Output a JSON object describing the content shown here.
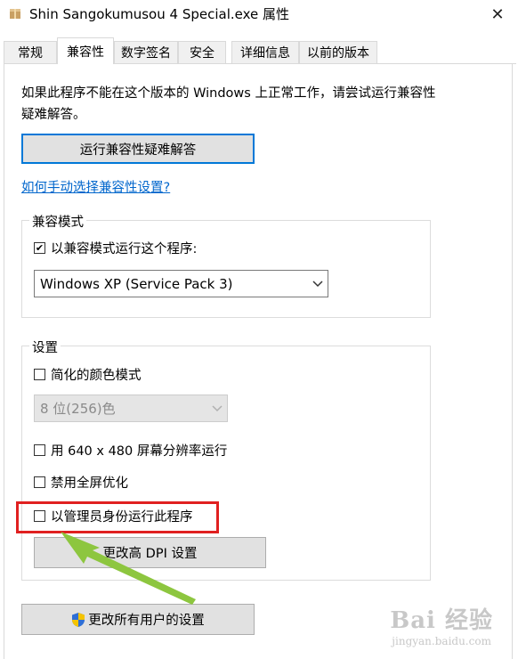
{
  "window": {
    "title": "Shin Sangokumusou 4 Special.exe 属性",
    "close_symbol": "✕"
  },
  "tabs": [
    {
      "label": "常规"
    },
    {
      "label": "兼容性"
    },
    {
      "label": "数字签名"
    },
    {
      "label": "安全"
    },
    {
      "label": "详细信息"
    },
    {
      "label": "以前的版本"
    }
  ],
  "active_tab": "兼容性",
  "intro_text": "如果此程序不能在这个版本的 Windows 上正常工作，请尝试运行兼容性疑难解答。",
  "troubleshooter_button": "运行兼容性疑难解答",
  "manual_link": "如何手动选择兼容性设置?",
  "compat_mode": {
    "group_label": "兼容模式",
    "checkbox_label": "以兼容模式运行这个程序:",
    "checked": true,
    "selected_os": "Windows XP (Service Pack 3)"
  },
  "settings": {
    "group_label": "设置",
    "reduced_color": {
      "label": "简化的颜色模式",
      "checked": false
    },
    "color_select": "8 位(256)色",
    "res_640": {
      "label": "用 640 x 480 屏幕分辨率运行",
      "checked": false
    },
    "fullscreen_opt": {
      "label": "禁用全屏优化",
      "checked": false
    },
    "run_as_admin": {
      "label": "以管理员身份运行此程序",
      "checked": false
    },
    "dpi_button": "更改高 DPI 设置"
  },
  "all_users_button": "更改所有用户的设置",
  "annotation": {
    "highlight_color": "#e02020",
    "arrow_color": "#8dc63f"
  },
  "watermark": {
    "brand": "Bai 经验",
    "domain": "jingyan.baidu.com"
  }
}
